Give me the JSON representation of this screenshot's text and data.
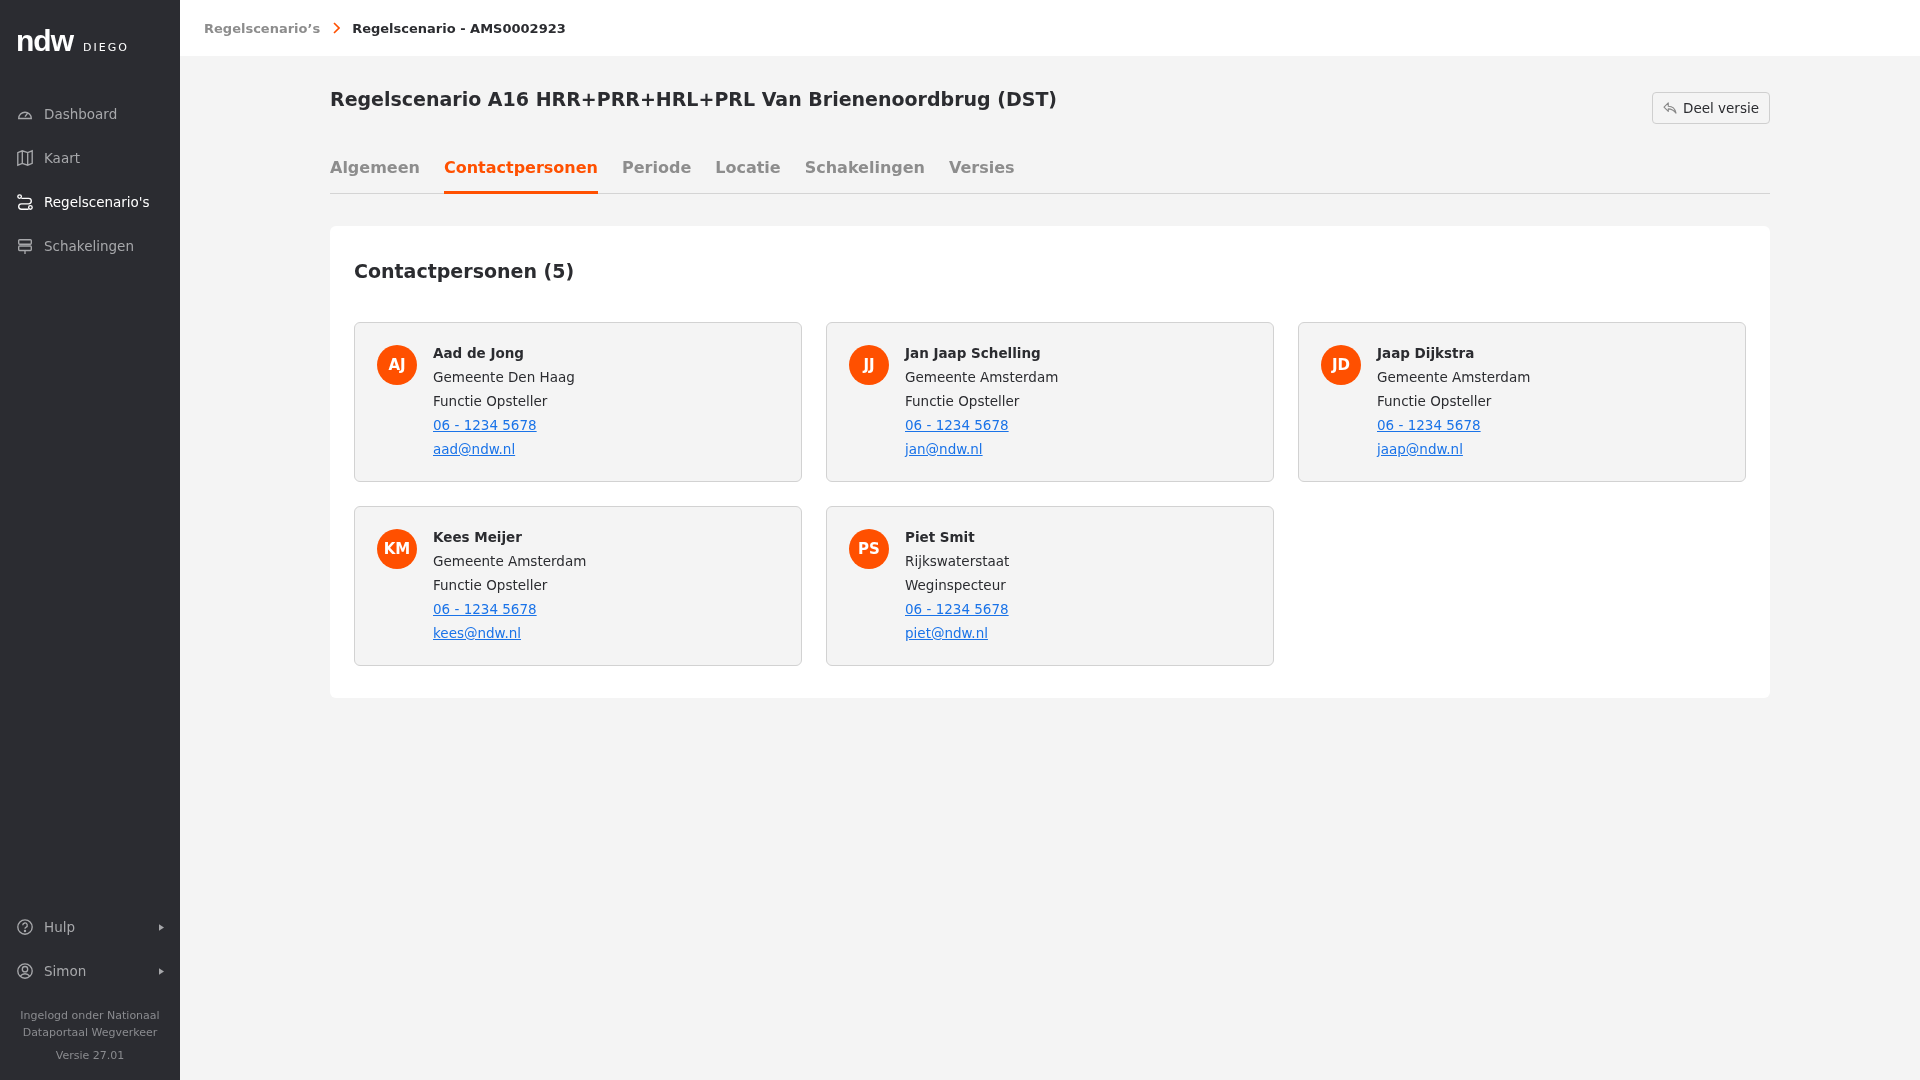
{
  "sidebar": {
    "logo": "ndw",
    "product": "DIEGO",
    "items": [
      {
        "label": "Dashboard",
        "selected": false
      },
      {
        "label": "Kaart",
        "selected": false
      },
      {
        "label": "Regelscenario's",
        "selected": true
      },
      {
        "label": "Schakelingen",
        "selected": false
      }
    ],
    "bottom_items": [
      {
        "label": "Hulp"
      },
      {
        "label": "Simon"
      }
    ],
    "login_note": "Ingelogd onder Nationaal Dataportaal Wegverkeer",
    "version": "Versie 27.01"
  },
  "breadcrumb": [
    "Regelscenario’s",
    "Regelscenario - AMS0002923"
  ],
  "page_title": "Regelscenario A16 HRR+PRR+HRL+PRL Van Brienenoordbrug (DST)",
  "share_button": "Deel versie",
  "tabs": [
    {
      "label": "Algemeen",
      "selected": false
    },
    {
      "label": "Contactpersonen",
      "selected": true
    },
    {
      "label": "Periode",
      "selected": false
    },
    {
      "label": "Locatie",
      "selected": false
    },
    {
      "label": "Schakelingen",
      "selected": false
    },
    {
      "label": "Versies",
      "selected": false
    }
  ],
  "section_title": "Contactpersonen (5)",
  "contacts": [
    {
      "initials": "AJ",
      "name": "Aad de Jong",
      "organisation": "Gemeente Den Haag",
      "role": "Functie Opsteller",
      "phone": "06 - 1234 5678",
      "email": "aad@ndw.nl"
    },
    {
      "initials": "JJ",
      "name": "Jan Jaap Schelling",
      "organisation": "Gemeente Amsterdam",
      "role": "Functie Opsteller",
      "phone": "06 - 1234 5678",
      "email": "jan@ndw.nl"
    },
    {
      "initials": "JD",
      "name": "Jaap Dijkstra",
      "organisation": "Gemeente Amsterdam",
      "role": "Functie Opsteller",
      "phone": "06 - 1234 5678",
      "email": "jaap@ndw.nl"
    },
    {
      "initials": "KM",
      "name": "Kees Meijer",
      "organisation": "Gemeente Amsterdam",
      "role": "Functie Opsteller",
      "phone": "06 - 1234 5678",
      "email": "kees@ndw.nl"
    },
    {
      "initials": "PS",
      "name": "Piet Smit",
      "organisation": "Rijkswaterstaat",
      "role": "Weginspecteur",
      "phone": "06 - 1234 5678",
      "email": "piet@ndw.nl"
    }
  ]
}
